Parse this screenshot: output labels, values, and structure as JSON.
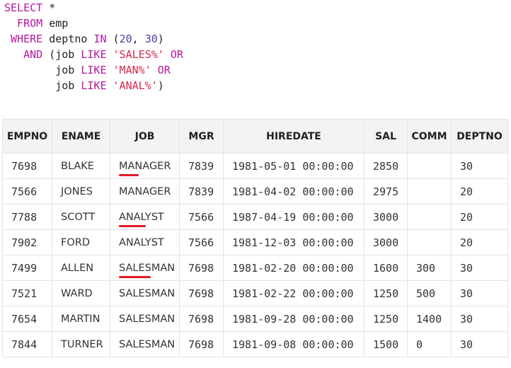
{
  "query": {
    "lines": [
      [
        {
          "t": "SELECT",
          "c": "kw"
        },
        {
          "t": " *",
          "c": "txt"
        }
      ],
      [
        {
          "t": "  FROM",
          "c": "kw"
        },
        {
          "t": " emp",
          "c": "txt"
        }
      ],
      [
        {
          "t": " WHERE",
          "c": "kw"
        },
        {
          "t": " deptno ",
          "c": "txt"
        },
        {
          "t": "IN",
          "c": "kw"
        },
        {
          "t": " (",
          "c": "txt"
        },
        {
          "t": "20",
          "c": "num"
        },
        {
          "t": ", ",
          "c": "txt"
        },
        {
          "t": "30",
          "c": "num"
        },
        {
          "t": ")",
          "c": "txt"
        }
      ],
      [
        {
          "t": "   AND",
          "c": "kw"
        },
        {
          "t": " (job ",
          "c": "txt"
        },
        {
          "t": "LIKE",
          "c": "kw"
        },
        {
          "t": " ",
          "c": "txt"
        },
        {
          "t": "'SALES%'",
          "c": "str"
        },
        {
          "t": " ",
          "c": "txt"
        },
        {
          "t": "OR",
          "c": "kw"
        }
      ],
      [
        {
          "t": "        job ",
          "c": "txt"
        },
        {
          "t": "LIKE",
          "c": "kw"
        },
        {
          "t": " ",
          "c": "txt"
        },
        {
          "t": "'MAN%'",
          "c": "str"
        },
        {
          "t": " ",
          "c": "txt"
        },
        {
          "t": "OR",
          "c": "kw"
        }
      ],
      [
        {
          "t": "        job ",
          "c": "txt"
        },
        {
          "t": "LIKE",
          "c": "kw"
        },
        {
          "t": " ",
          "c": "txt"
        },
        {
          "t": "'ANAL%'",
          "c": "str"
        },
        {
          "t": ")",
          "c": "txt"
        }
      ]
    ]
  },
  "table": {
    "columns": [
      "EMPNO",
      "ENAME",
      "JOB",
      "MGR",
      "HIREDATE",
      "SAL",
      "COMM",
      "DEPTNO"
    ],
    "rows": [
      [
        "7698",
        "BLAKE",
        "MANAGER",
        "7839",
        "1981-05-01 00:00:00",
        "2850",
        "",
        "30"
      ],
      [
        "7566",
        "JONES",
        "MANAGER",
        "7839",
        "1981-04-02 00:00:00",
        "2975",
        "",
        "20"
      ],
      [
        "7788",
        "SCOTT",
        "ANALYST",
        "7566",
        "1987-04-19 00:00:00",
        "3000",
        "",
        "20"
      ],
      [
        "7902",
        "FORD",
        "ANALYST",
        "7566",
        "1981-12-03 00:00:00",
        "3000",
        "",
        "20"
      ],
      [
        "7499",
        "ALLEN",
        "SALESMAN",
        "7698",
        "1981-02-20 00:00:00",
        "1600",
        "300",
        "30"
      ],
      [
        "7521",
        "WARD",
        "SALESMAN",
        "7698",
        "1981-02-22 00:00:00",
        "1250",
        "500",
        "30"
      ],
      [
        "7654",
        "MARTIN",
        "SALESMAN",
        "7698",
        "1981-09-28 00:00:00",
        "1250",
        "1400",
        "30"
      ],
      [
        "7844",
        "TURNER",
        "SALESMAN",
        "7698",
        "1981-09-08 00:00:00",
        "1500",
        "0",
        "30"
      ]
    ],
    "highlights": [
      {
        "row": 0,
        "col": 2,
        "prefix": "MAN"
      },
      {
        "row": 2,
        "col": 2,
        "prefix": "ANAL"
      },
      {
        "row": 4,
        "col": 2,
        "prefix": "SALES"
      }
    ],
    "highlight_color": "#e11b22"
  },
  "colors": {
    "keyword": "#b5179e",
    "number": "#4b3ea8",
    "string": "#d6284a",
    "text": "#222222",
    "header_bg": "#f3f3f3",
    "border": "#e3e3e3"
  }
}
